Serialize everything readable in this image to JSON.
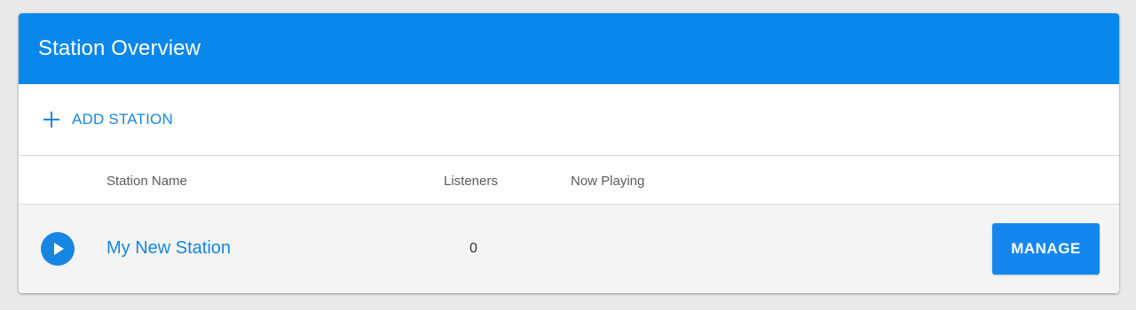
{
  "card": {
    "title": "Station Overview",
    "header_color": "#0a87ea"
  },
  "toolbar": {
    "add_station_label": "ADD STATION",
    "add_icon": "plus-icon"
  },
  "table": {
    "columns": [
      "Station Name",
      "Listeners",
      "Now Playing"
    ],
    "rows": [
      {
        "play_icon": "play-circle-icon",
        "name": "My New Station",
        "listeners": "0",
        "now_playing": "",
        "action_label": "MANAGE"
      }
    ]
  },
  "colors": {
    "accent": "#1686e2",
    "row_background": "#f4f4f4"
  }
}
